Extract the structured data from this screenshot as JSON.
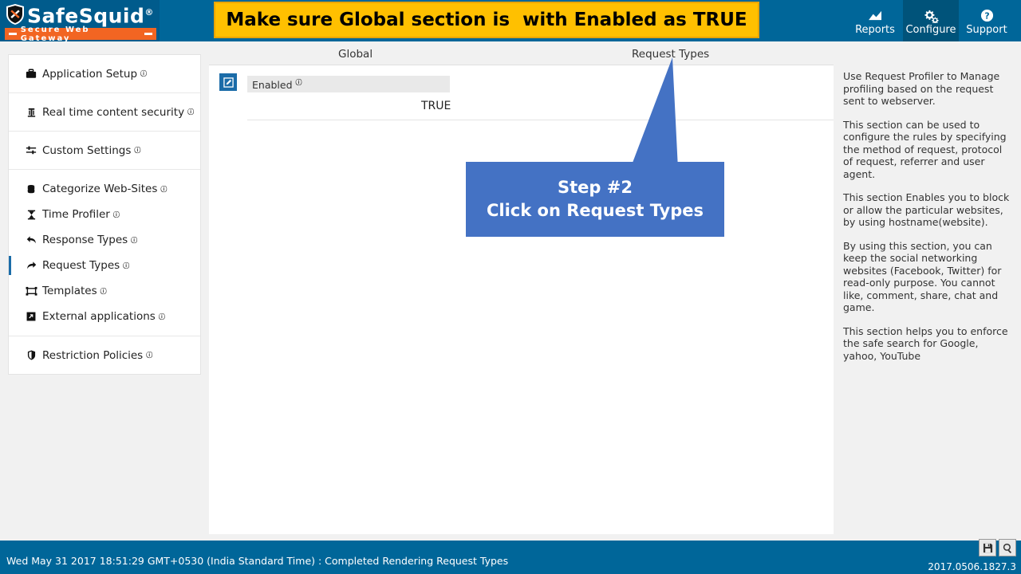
{
  "app": {
    "logo_name": "SafeSquid",
    "logo_reg": "®",
    "tagline": "Secure Web Gateway"
  },
  "banner": {
    "text": "Make sure Global section is  with Enabled as TRUE"
  },
  "topnav": {
    "items": [
      {
        "label": "Reports",
        "icon": "chart-icon",
        "active": false
      },
      {
        "label": "Configure",
        "icon": "gears-icon",
        "active": true
      },
      {
        "label": "Support",
        "icon": "question-circle-icon",
        "active": false
      }
    ]
  },
  "sidebar": {
    "groups": [
      {
        "items": [
          {
            "label": "Application Setup",
            "icon": "briefcase-icon",
            "badge": "ⓘ",
            "active": false
          }
        ]
      },
      {
        "items": [
          {
            "label": "Real time content security",
            "icon": "bug-shield-icon",
            "badge": "ⓘ",
            "active": false
          }
        ]
      },
      {
        "items": [
          {
            "label": "Custom Settings",
            "icon": "sliders-icon",
            "badge": "ⓘ",
            "active": false
          }
        ]
      },
      {
        "items": [
          {
            "label": "Categorize Web-Sites",
            "icon": "database-icon",
            "badge": "ⓘ",
            "active": false
          },
          {
            "label": "Time Profiler",
            "icon": "hourglass-icon",
            "badge": "ⓘ",
            "active": false
          },
          {
            "label": "Response Types",
            "icon": "arrow-return-left-icon",
            "badge": "ⓘ",
            "active": false
          },
          {
            "label": "Request Types",
            "icon": "arrow-return-right-icon",
            "badge": "ⓘ",
            "active": true
          },
          {
            "label": "Templates",
            "icon": "templates-icon",
            "badge": "ⓘ",
            "active": false
          },
          {
            "label": "External applications",
            "icon": "external-app-icon",
            "badge": "ⓘ",
            "active": false
          }
        ]
      },
      {
        "items": [
          {
            "label": "Restriction Policies",
            "icon": "shield-icon",
            "badge": "ⓘ",
            "active": false
          }
        ]
      }
    ]
  },
  "main": {
    "tabs": [
      {
        "label": "Global",
        "active": false
      },
      {
        "label": "Request Types",
        "active": false
      }
    ],
    "row": {
      "edit_icon": "edit-pencil-icon",
      "field_label": "Enabled",
      "field_badge": "ⓘ",
      "field_value": "TRUE"
    }
  },
  "callout": {
    "line1": "Step #2",
    "line2": "Click on Request Types",
    "color": "#4472c4"
  },
  "help": {
    "paragraphs": [
      "Use Request Profiler to Manage profiling based on the request sent to webserver.",
      "This section can be used to configure the rules by specifying the method of request, protocol of request, referrer and user agent.",
      "This section Enables you to block or allow the particular websites, by using hostname(website).",
      "By using this section, you can keep the social networking websites (Facebook, Twitter) for read-only purpose. You cannot like, comment, share, chat and game.",
      "This section helps you to enforce the safe search for Google, yahoo, YouTube"
    ]
  },
  "footer": {
    "status": "Wed May 31 2017 18:51:29 GMT+0530 (India Standard Time) : Completed Rendering Request Types",
    "version": "2017.0506.1827.3",
    "buttons": [
      {
        "name": "save-icon"
      },
      {
        "name": "search-icon"
      }
    ]
  },
  "colors": {
    "header_blue": "#006699",
    "banner_yellow": "#ffc000",
    "accent_blue": "#1b6ca8",
    "callout_blue": "#4472c4",
    "tagline_orange": "#f26522"
  }
}
